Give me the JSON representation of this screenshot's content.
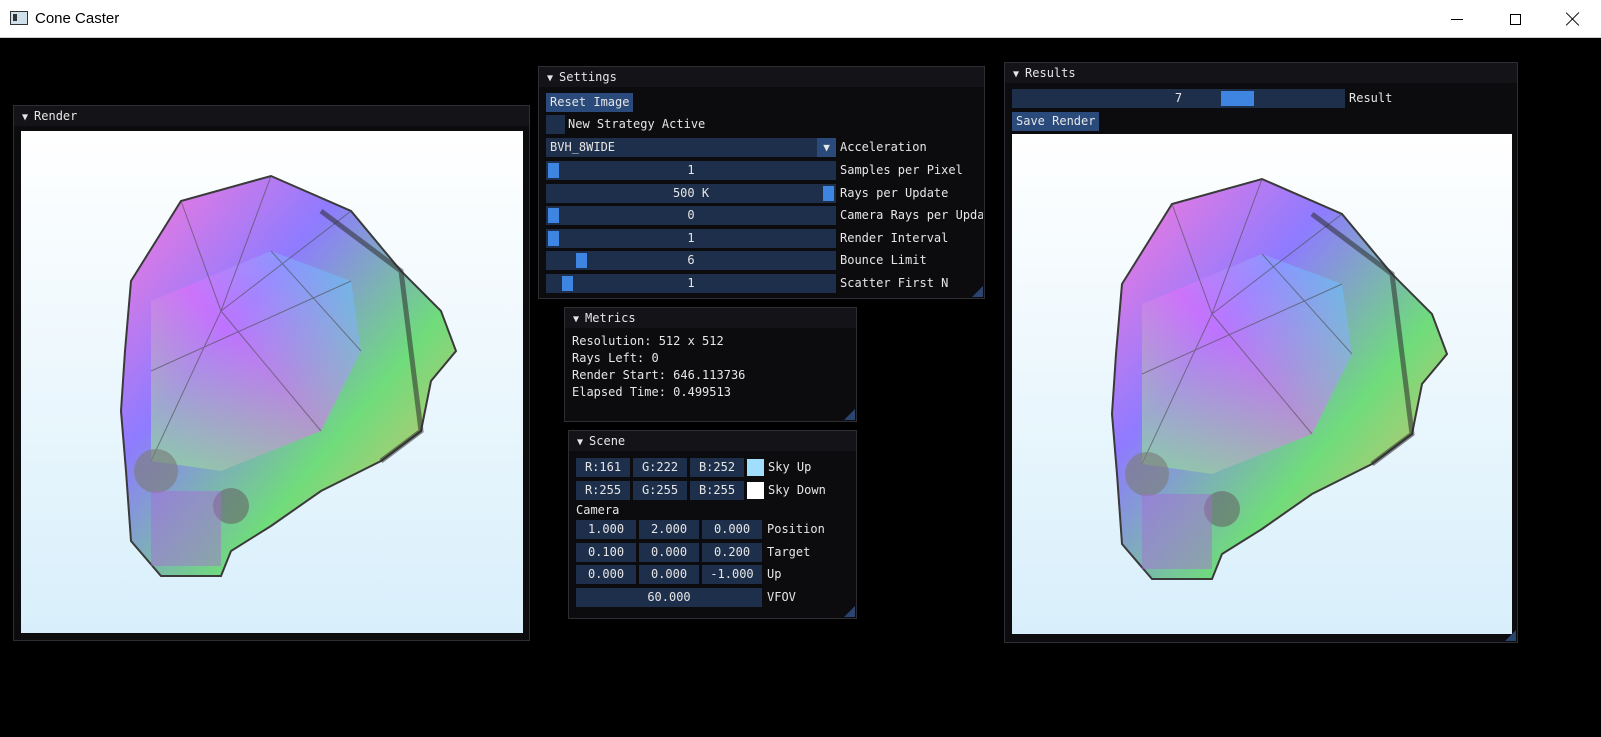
{
  "window": {
    "title": "Cone Caster"
  },
  "render_panel": {
    "title": "Render"
  },
  "settings": {
    "title": "Settings",
    "reset_label": "Reset Image",
    "new_strategy_label": "New Strategy Active",
    "new_strategy_checked": false,
    "acceleration_value": "BVH_8WIDE",
    "acceleration_label": "Acceleration",
    "sliders": [
      {
        "label": "Samples per Pixel",
        "value": "1",
        "level": 0.0
      },
      {
        "label": "Rays per Update",
        "value": "500 K",
        "level": 1.0
      },
      {
        "label": "Camera Rays per Update",
        "value": "0",
        "level": 0.0
      },
      {
        "label": "Render Interval",
        "value": "1",
        "level": 0.0
      },
      {
        "label": "Bounce Limit",
        "value": "6",
        "level": 0.1
      },
      {
        "label": "Scatter First N",
        "value": "1",
        "level": 0.05
      }
    ]
  },
  "metrics": {
    "title": "Metrics",
    "resolution": "Resolution: 512 x 512",
    "rays_left": "Rays Left: 0",
    "render_start": "Render Start: 646.113736",
    "elapsed": "Elapsed Time: 0.499513"
  },
  "scene": {
    "title": "Scene",
    "sky_up": {
      "r": "R:161",
      "g": "G:222",
      "b": "B:252",
      "label": "Sky Up",
      "color": "#a1defc"
    },
    "sky_down": {
      "r": "R:255",
      "g": "G:255",
      "b": "B:255",
      "label": "Sky Down",
      "color": "#ffffff"
    },
    "camera_label": "Camera",
    "position": {
      "x": "1.000",
      "y": "2.000",
      "z": "0.000",
      "label": "Position"
    },
    "target": {
      "x": "0.100",
      "y": "0.000",
      "z": "0.200",
      "label": "Target"
    },
    "up": {
      "x": "0.000",
      "y": "0.000",
      "z": "-1.000",
      "label": "Up"
    },
    "vfov": {
      "value": "60.000",
      "label": "VFOV"
    }
  },
  "results": {
    "title": "Results",
    "slider_value": "7",
    "slider_level": 0.7,
    "slider_label": "Result",
    "save_label": "Save Render"
  },
  "colors": {
    "accent": "#3d85e0",
    "frame": "#1d2f4b",
    "button": "#294a7a",
    "panel_bg": "#0c0c0e"
  }
}
